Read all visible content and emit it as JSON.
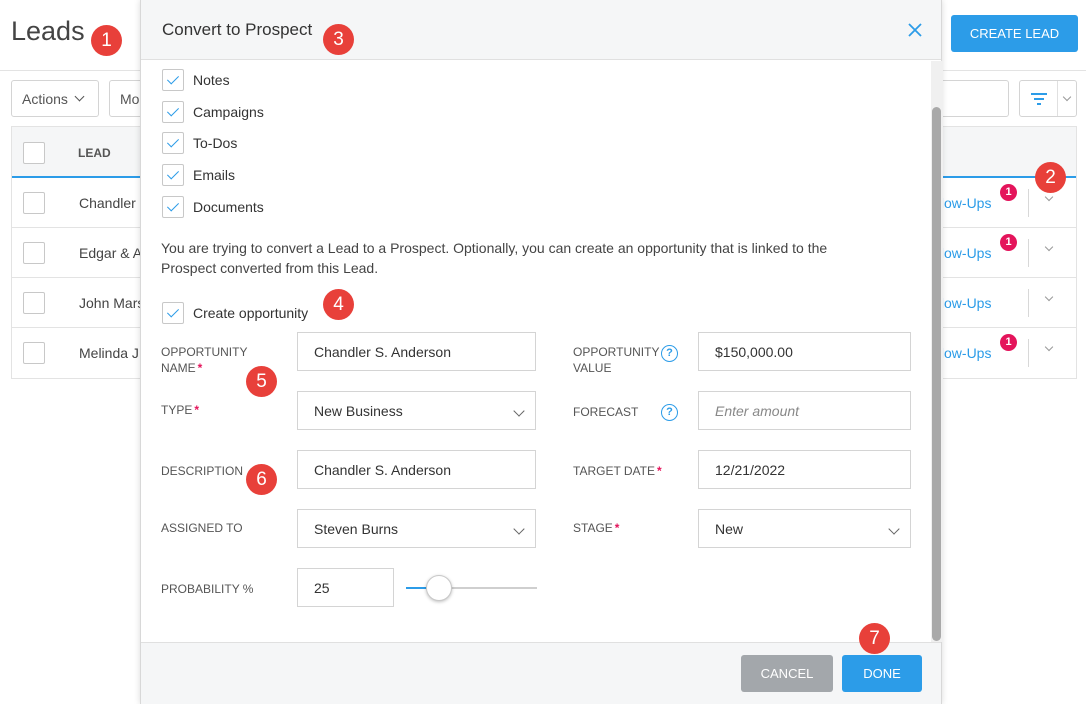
{
  "page": {
    "title": "Leads",
    "create_button": "CREATE LEAD",
    "actions_button": "Actions",
    "more_button": "Mo",
    "table": {
      "header_lead": "LEAD",
      "rows": [
        {
          "name": "Chandler",
          "follow_ups": "ollow-Ups",
          "notification": "1"
        },
        {
          "name": "Edgar & A",
          "follow_ups": "ollow-Ups",
          "notification": "1"
        },
        {
          "name": "John Mars",
          "follow_ups": "ollow-Ups",
          "notification": ""
        },
        {
          "name": "Melinda J",
          "follow_ups": "ollow-Ups",
          "notification": "1"
        }
      ]
    }
  },
  "modal": {
    "title": "Convert to Prospect",
    "checkboxes": [
      "Notes",
      "Campaigns",
      "To-Dos",
      "Emails",
      "Documents"
    ],
    "info_text": "You are trying to convert a Lead to a Prospect. Optionally, you can create an opportunity that is linked to the Prospect converted from this Lead.",
    "create_opportunity_label": "Create opportunity",
    "fields": {
      "opportunity_name": {
        "label": "OPPORTUNITY NAME",
        "value": "Chandler S. Anderson",
        "required": true
      },
      "opportunity_value": {
        "label": "OPPORTUNITY VALUE",
        "value": "$150,000.00"
      },
      "type": {
        "label": "TYPE",
        "value": "New Business",
        "required": true
      },
      "forecast": {
        "label": "FORECAST",
        "placeholder": "Enter amount"
      },
      "description": {
        "label": "DESCRIPTION",
        "value": "Chandler S. Anderson"
      },
      "target_date": {
        "label": "TARGET DATE",
        "value": "12/21/2022",
        "required": true
      },
      "assigned_to": {
        "label": "ASSIGNED TO",
        "value": "Steven Burns"
      },
      "stage": {
        "label": "STAGE",
        "value": "New",
        "required": true
      },
      "probability": {
        "label": "PROBABILITY %",
        "value": "25",
        "slider_fraction": 0.25
      }
    },
    "cancel_button": "CANCEL",
    "done_button": "DONE"
  },
  "markers": [
    "1",
    "2",
    "3",
    "4",
    "5",
    "6",
    "7"
  ],
  "colors": {
    "accent": "#2c9ce8",
    "notification": "#e4145b",
    "marker": "#e8403a",
    "cancel": "#a3a7ab"
  }
}
